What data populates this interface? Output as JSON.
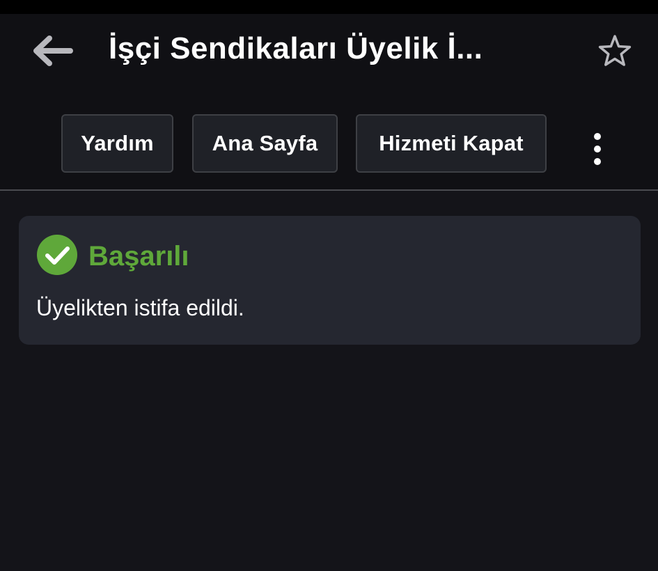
{
  "header": {
    "title": "İşçi Sendikaları Üyelik İ...",
    "back_icon": "arrow-left-icon",
    "favorite_icon": "star-outline-icon"
  },
  "toolbar": {
    "help_label": "Yardım",
    "home_label": "Ana Sayfa",
    "close_service_label": "Hizmeti Kapat",
    "more_icon": "more-vertical-icon"
  },
  "alert": {
    "status": "success",
    "icon": "check-circle-icon",
    "title": "Başarılı",
    "message": "Üyelikten istifa edildi."
  },
  "colors": {
    "background": "#141419",
    "header_background": "#101014",
    "card_background": "#252730",
    "button_background": "#1f2127",
    "button_border": "#3e4045",
    "success": "#5fa83a",
    "icon_gray": "#b8b8bd",
    "text": "#ffffff"
  }
}
